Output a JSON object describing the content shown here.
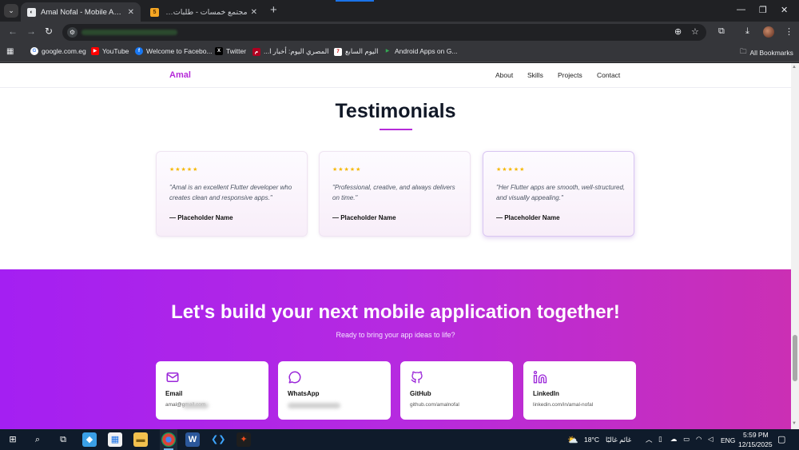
{
  "browser": {
    "tabs": [
      {
        "title": "Amal Nofal - Mobile Application",
        "active": true
      },
      {
        "title": "مجتمع خمسات - طلبات الخدمات",
        "active": false
      }
    ],
    "bookmarks": [
      {
        "label": "google.com.eg",
        "icon": "google-icon"
      },
      {
        "label": "YouTube",
        "icon": "youtube-icon"
      },
      {
        "label": "Welcome to Facebo...",
        "icon": "facebook-icon"
      },
      {
        "label": "Twitter",
        "icon": "x-icon"
      },
      {
        "label": "المصري اليوم: أخبار ا...",
        "icon": "masry-icon"
      },
      {
        "label": "اليوم السابع",
        "icon": "youm7-icon"
      },
      {
        "label": "Android Apps on G...",
        "icon": "play-store-icon"
      }
    ],
    "all_bookmarks": "All Bookmarks"
  },
  "site": {
    "logo": "Amal",
    "nav": [
      "About",
      "Skills",
      "Projects",
      "Contact"
    ]
  },
  "testimonials": {
    "title": "Testimonials",
    "stars": "★★★★★",
    "items": [
      {
        "quote": "\"Amal is an excellent Flutter developer who creates clean and responsive apps.\"",
        "author": "— Placeholder Name"
      },
      {
        "quote": "\"Professional, creative, and always delivers on time.\"",
        "author": "— Placeholder Name"
      },
      {
        "quote": "\"Her Flutter apps are smooth, well-structured, and visually appealing.\"",
        "author": "— Placeholder Name"
      }
    ]
  },
  "cta": {
    "title": "Let's build your next mobile application together!",
    "subtitle": "Ready to bring your app ideas to life?",
    "contacts": [
      {
        "label": "Email",
        "value": "amal@gmail.com",
        "icon": "mail-icon"
      },
      {
        "label": "WhatsApp",
        "value": "",
        "icon": "chat-bubble-icon"
      },
      {
        "label": "GitHub",
        "value": "github.com/amalnofal",
        "icon": "github-icon"
      },
      {
        "label": "LinkedIn",
        "value": "linkedin.com/in/amal-nofal",
        "icon": "linkedin-icon"
      }
    ]
  },
  "taskbar": {
    "weather": "18°C",
    "weather_text": "غائم غالبًا",
    "lang": "ENG",
    "time": "5:59 PM",
    "date": "12/15/2025"
  },
  "colors": {
    "accent": "#b52bd9",
    "cta_gradient_start": "#a41ff2",
    "cta_gradient_end": "#cb2fb4",
    "star": "#f5b800"
  }
}
